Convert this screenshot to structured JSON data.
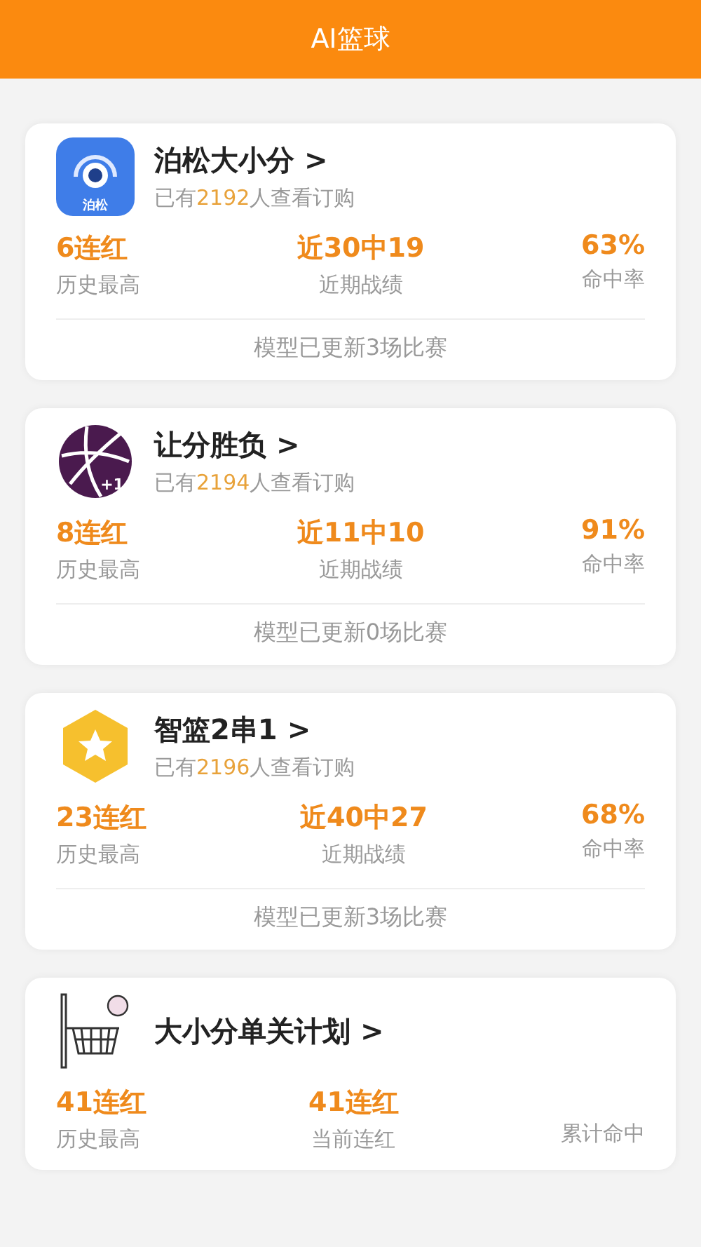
{
  "header": {
    "title": "AI篮球"
  },
  "cards": [
    {
      "icon": {
        "kind": "logo",
        "label": "泊松"
      },
      "title": "泊松大小分",
      "chevron": ">",
      "subscribers": {
        "before": "已有",
        "count": "2192",
        "after": "人查看订购"
      },
      "stats": [
        {
          "value": "6连红",
          "label": "历史最高"
        },
        {
          "value": "近30中19",
          "label": "近期战绩"
        },
        {
          "value": "63%",
          "label": "命中率"
        }
      ],
      "footer": "模型已更新3场比赛"
    },
    {
      "icon": {
        "kind": "basketball",
        "label": "+1"
      },
      "title": "让分胜负",
      "chevron": ">",
      "subscribers": {
        "before": "已有",
        "count": "2194",
        "after": "人查看订购"
      },
      "stats": [
        {
          "value": "8连红",
          "label": "历史最高"
        },
        {
          "value": "近11中10",
          "label": "近期战绩"
        },
        {
          "value": "91%",
          "label": "命中率"
        }
      ],
      "footer": "模型已更新0场比赛"
    },
    {
      "icon": {
        "kind": "star"
      },
      "title": "智篮2串1",
      "chevron": ">",
      "subscribers": {
        "before": "已有",
        "count": "2196",
        "after": "人查看订购"
      },
      "stats": [
        {
          "value": "23连红",
          "label": "历史最高"
        },
        {
          "value": "近40中27",
          "label": "近期战绩"
        },
        {
          "value": "68%",
          "label": "命中率"
        }
      ],
      "footer": "模型已更新3场比赛"
    },
    {
      "icon": {
        "kind": "hoop"
      },
      "title": "大小分单关计划",
      "chevron": ">",
      "stats": [
        {
          "value": "41连红",
          "label": "历史最高"
        },
        {
          "value": "41连红",
          "label": "当前连红"
        },
        {
          "label": "累计命中"
        }
      ]
    }
  ]
}
